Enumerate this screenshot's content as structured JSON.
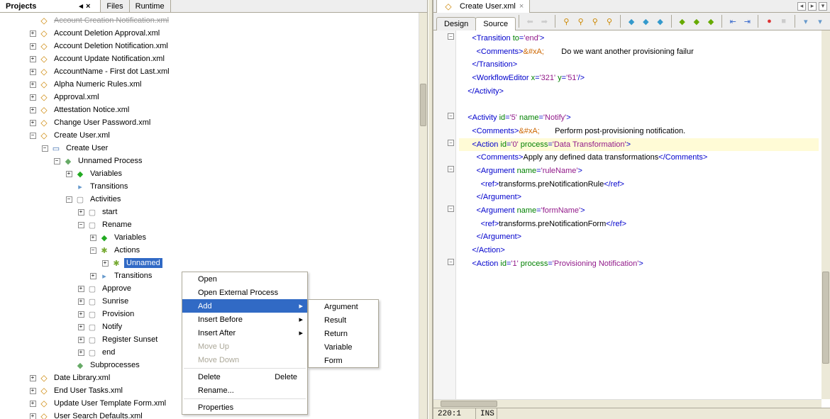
{
  "left_tabs": {
    "projects": "Projects",
    "files": "Files",
    "runtime": "Runtime"
  },
  "tree": {
    "truncated_top": "Account Creation Notification.xml",
    "files": [
      "Account Deletion Approval.xml",
      "Account Deletion Notification.xml",
      "Account Update Notification.xml",
      "AccountName - First dot Last.xml",
      "Alpha Numeric Rules.xml",
      "Approval.xml",
      "Attestation Notice.xml",
      "Change User Password.xml"
    ],
    "create_user_file": "Create User.xml",
    "create_user": "Create User",
    "unnamed_process": "Unnamed Process",
    "variables": "Variables",
    "transitions": "Transitions",
    "activities": "Activities",
    "start": "start",
    "rename": "Rename",
    "actions": "Actions",
    "unnamed": "Unnamed",
    "approve": "Approve",
    "sunrise": "Sunrise",
    "provision": "Provision",
    "notify": "Notify",
    "register_sunset": "Register Sunset",
    "end": "end",
    "subprocesses": "Subprocesses",
    "tail_files": [
      "Date Library.xml",
      "End User Tasks.xml",
      "Update User Template Form.xml",
      "User Search Defaults.xml"
    ]
  },
  "ctx1": {
    "open": "Open",
    "open_ext": "Open External Process",
    "add": "Add",
    "ins_before": "Insert Before",
    "ins_after": "Insert After",
    "move_up": "Move Up",
    "move_down": "Move Down",
    "delete": "Delete",
    "delete_accel": "Delete",
    "rename": "Rename...",
    "properties": "Properties"
  },
  "ctx2": {
    "argument": "Argument",
    "result": "Result",
    "return": "Return",
    "variable": "Variable",
    "form": "Form"
  },
  "editor": {
    "tab_title": "Create User.xml",
    "design": "Design",
    "source": "Source",
    "status_pos": "220:1",
    "status_mode": "INS"
  },
  "code_lines": [
    {
      "indent": 3,
      "frags": [
        {
          "c": "t-tag",
          "t": "<Transition "
        },
        {
          "c": "t-attr",
          "t": "to"
        },
        {
          "c": "t-tag",
          "t": "="
        },
        {
          "c": "t-val",
          "t": "'end'"
        },
        {
          "c": "t-tag",
          "t": ">"
        }
      ],
      "fold": "-"
    },
    {
      "indent": 4,
      "frags": [
        {
          "c": "t-tag",
          "t": "<Comments>"
        },
        {
          "c": "t-ent",
          "t": "&#xA;"
        },
        {
          "c": "t-txt",
          "t": "        Do we want another provisioning failur"
        }
      ]
    },
    {
      "indent": 3,
      "frags": [
        {
          "c": "t-tag",
          "t": "</Transition>"
        }
      ]
    },
    {
      "indent": 3,
      "frags": [
        {
          "c": "t-tag",
          "t": "<WorkflowEditor "
        },
        {
          "c": "t-attr",
          "t": "x"
        },
        {
          "c": "t-tag",
          "t": "="
        },
        {
          "c": "t-val",
          "t": "'321'"
        },
        {
          "c": "t-tag",
          "t": " "
        },
        {
          "c": "t-attr",
          "t": "y"
        },
        {
          "c": "t-tag",
          "t": "="
        },
        {
          "c": "t-val",
          "t": "'51'"
        },
        {
          "c": "t-tag",
          "t": "/>"
        }
      ]
    },
    {
      "indent": 2,
      "frags": [
        {
          "c": "t-tag",
          "t": "</Activity>"
        }
      ]
    },
    {
      "indent": 0,
      "frags": [
        {
          "c": "",
          "t": ""
        }
      ]
    },
    {
      "indent": 2,
      "frags": [
        {
          "c": "t-tag",
          "t": "<Activity "
        },
        {
          "c": "t-attr",
          "t": "id"
        },
        {
          "c": "t-tag",
          "t": "="
        },
        {
          "c": "t-val",
          "t": "'5'"
        },
        {
          "c": "t-tag",
          "t": " "
        },
        {
          "c": "t-attr",
          "t": "name"
        },
        {
          "c": "t-tag",
          "t": "="
        },
        {
          "c": "t-val",
          "t": "'Notify'"
        },
        {
          "c": "t-tag",
          "t": ">"
        }
      ],
      "fold": "-"
    },
    {
      "indent": 3,
      "frags": [
        {
          "c": "t-tag",
          "t": "<Comments>"
        },
        {
          "c": "t-ent",
          "t": "&#xA;"
        },
        {
          "c": "t-txt",
          "t": "       Perform post-provisioning notification.  "
        }
      ]
    },
    {
      "indent": 3,
      "hl": true,
      "frags": [
        {
          "c": "t-tag",
          "t": "<Action "
        },
        {
          "c": "t-attr",
          "t": "id"
        },
        {
          "c": "t-tag",
          "t": "="
        },
        {
          "c": "t-val",
          "t": "'0'"
        },
        {
          "c": "t-tag",
          "t": " "
        },
        {
          "c": "t-attr",
          "t": "process"
        },
        {
          "c": "t-tag",
          "t": "="
        },
        {
          "c": "t-val",
          "t": "'Data Transformation'"
        },
        {
          "c": "t-tag",
          "t": ">"
        }
      ],
      "fold": "-"
    },
    {
      "indent": 4,
      "frags": [
        {
          "c": "t-tag",
          "t": "<Comments>"
        },
        {
          "c": "t-txt",
          "t": "Apply any defined data transformations"
        },
        {
          "c": "t-tag",
          "t": "</Comments>"
        }
      ]
    },
    {
      "indent": 4,
      "frags": [
        {
          "c": "t-tag",
          "t": "<Argument "
        },
        {
          "c": "t-attr",
          "t": "name"
        },
        {
          "c": "t-tag",
          "t": "="
        },
        {
          "c": "t-val",
          "t": "'ruleName'"
        },
        {
          "c": "t-tag",
          "t": ">"
        }
      ],
      "fold": "-"
    },
    {
      "indent": 5,
      "frags": [
        {
          "c": "t-tag",
          "t": "<ref>"
        },
        {
          "c": "t-txt",
          "t": "transforms.preNotificationRule"
        },
        {
          "c": "t-tag",
          "t": "</ref>"
        }
      ]
    },
    {
      "indent": 4,
      "frags": [
        {
          "c": "t-tag",
          "t": "</Argument>"
        }
      ]
    },
    {
      "indent": 4,
      "frags": [
        {
          "c": "t-tag",
          "t": "<Argument "
        },
        {
          "c": "t-attr",
          "t": "name"
        },
        {
          "c": "t-tag",
          "t": "="
        },
        {
          "c": "t-val",
          "t": "'formName'"
        },
        {
          "c": "t-tag",
          "t": ">"
        }
      ],
      "fold": "-"
    },
    {
      "indent": 5,
      "frags": [
        {
          "c": "t-tag",
          "t": "<ref>"
        },
        {
          "c": "t-txt",
          "t": "transforms.preNotificationForm"
        },
        {
          "c": "t-tag",
          "t": "</ref>"
        }
      ]
    },
    {
      "indent": 4,
      "frags": [
        {
          "c": "t-tag",
          "t": "</Argument>"
        }
      ]
    },
    {
      "indent": 3,
      "frags": [
        {
          "c": "t-tag",
          "t": "</Action>"
        }
      ]
    },
    {
      "indent": 3,
      "frags": [
        {
          "c": "t-tag",
          "t": "<Action "
        },
        {
          "c": "t-attr",
          "t": "id"
        },
        {
          "c": "t-tag",
          "t": "="
        },
        {
          "c": "t-val",
          "t": "'1'"
        },
        {
          "c": "t-tag",
          "t": " "
        },
        {
          "c": "t-attr",
          "t": "process"
        },
        {
          "c": "t-tag",
          "t": "="
        },
        {
          "c": "t-val",
          "t": "'Provisioning Notification'"
        },
        {
          "c": "t-tag",
          "t": ">"
        }
      ],
      "fold": "-"
    }
  ]
}
